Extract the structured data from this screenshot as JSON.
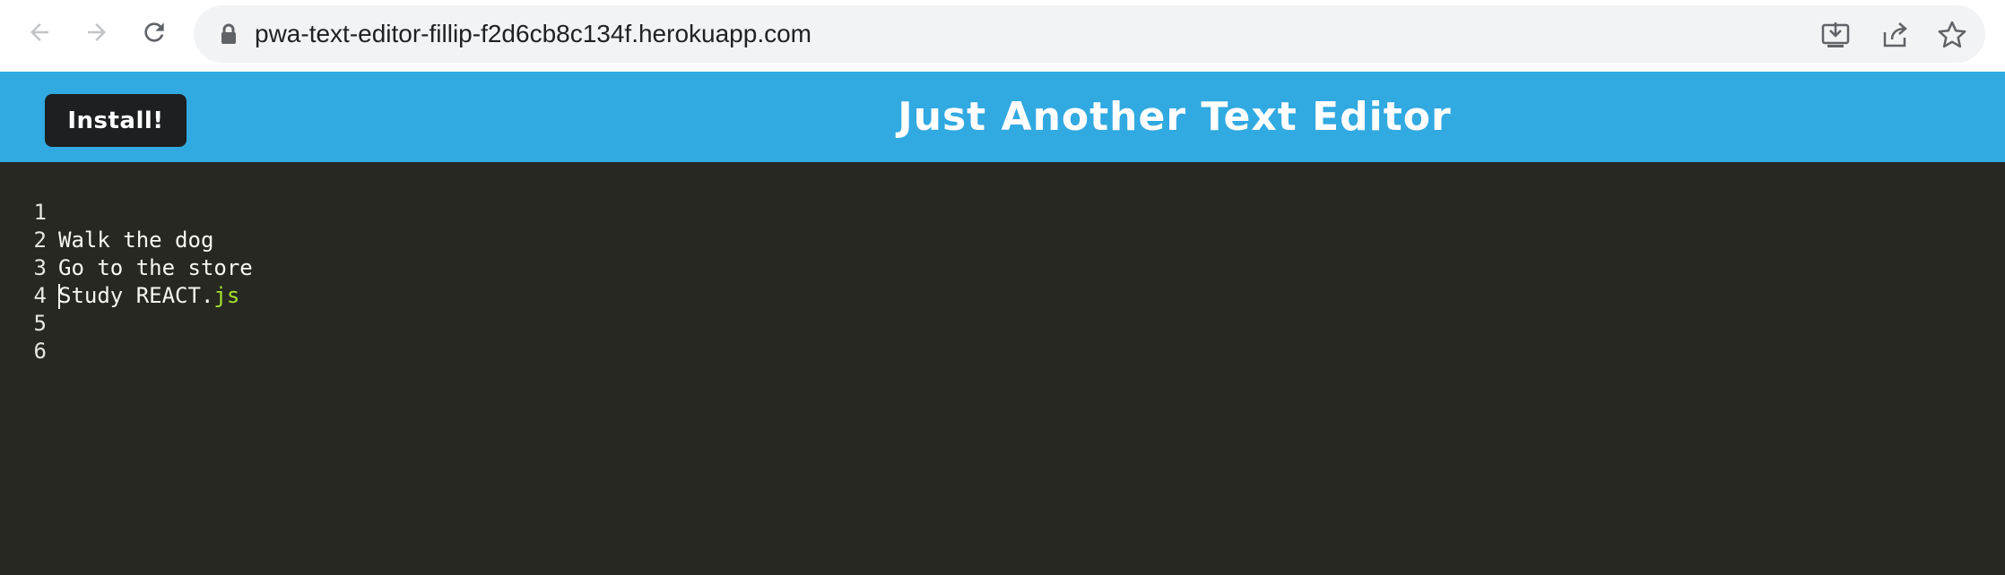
{
  "browser": {
    "url": "pwa-text-editor-fillip-f2d6cb8c134f.herokuapp.com",
    "icons": {
      "back": "arrow-left-icon",
      "forward": "arrow-right-icon",
      "reload": "reload-icon",
      "lock": "lock-icon",
      "install_app": "install-app-icon",
      "share": "share-icon",
      "bookmark": "star-icon"
    }
  },
  "header": {
    "install_label": "Install!",
    "title": "Just Another Text Editor",
    "background_color": "#31a9e1"
  },
  "editor": {
    "background_color": "#272822",
    "lines": [
      {
        "number": "1",
        "text": "Walk the dog"
      },
      {
        "number": "2",
        "text": "Go to the store"
      },
      {
        "number": "3",
        "text": "Study REACT.",
        "token": "js"
      },
      {
        "number": "4",
        "text": ""
      },
      {
        "number": "5",
        "text": ""
      },
      {
        "number": "6",
        "text": ""
      }
    ],
    "cursor_line": "5"
  }
}
